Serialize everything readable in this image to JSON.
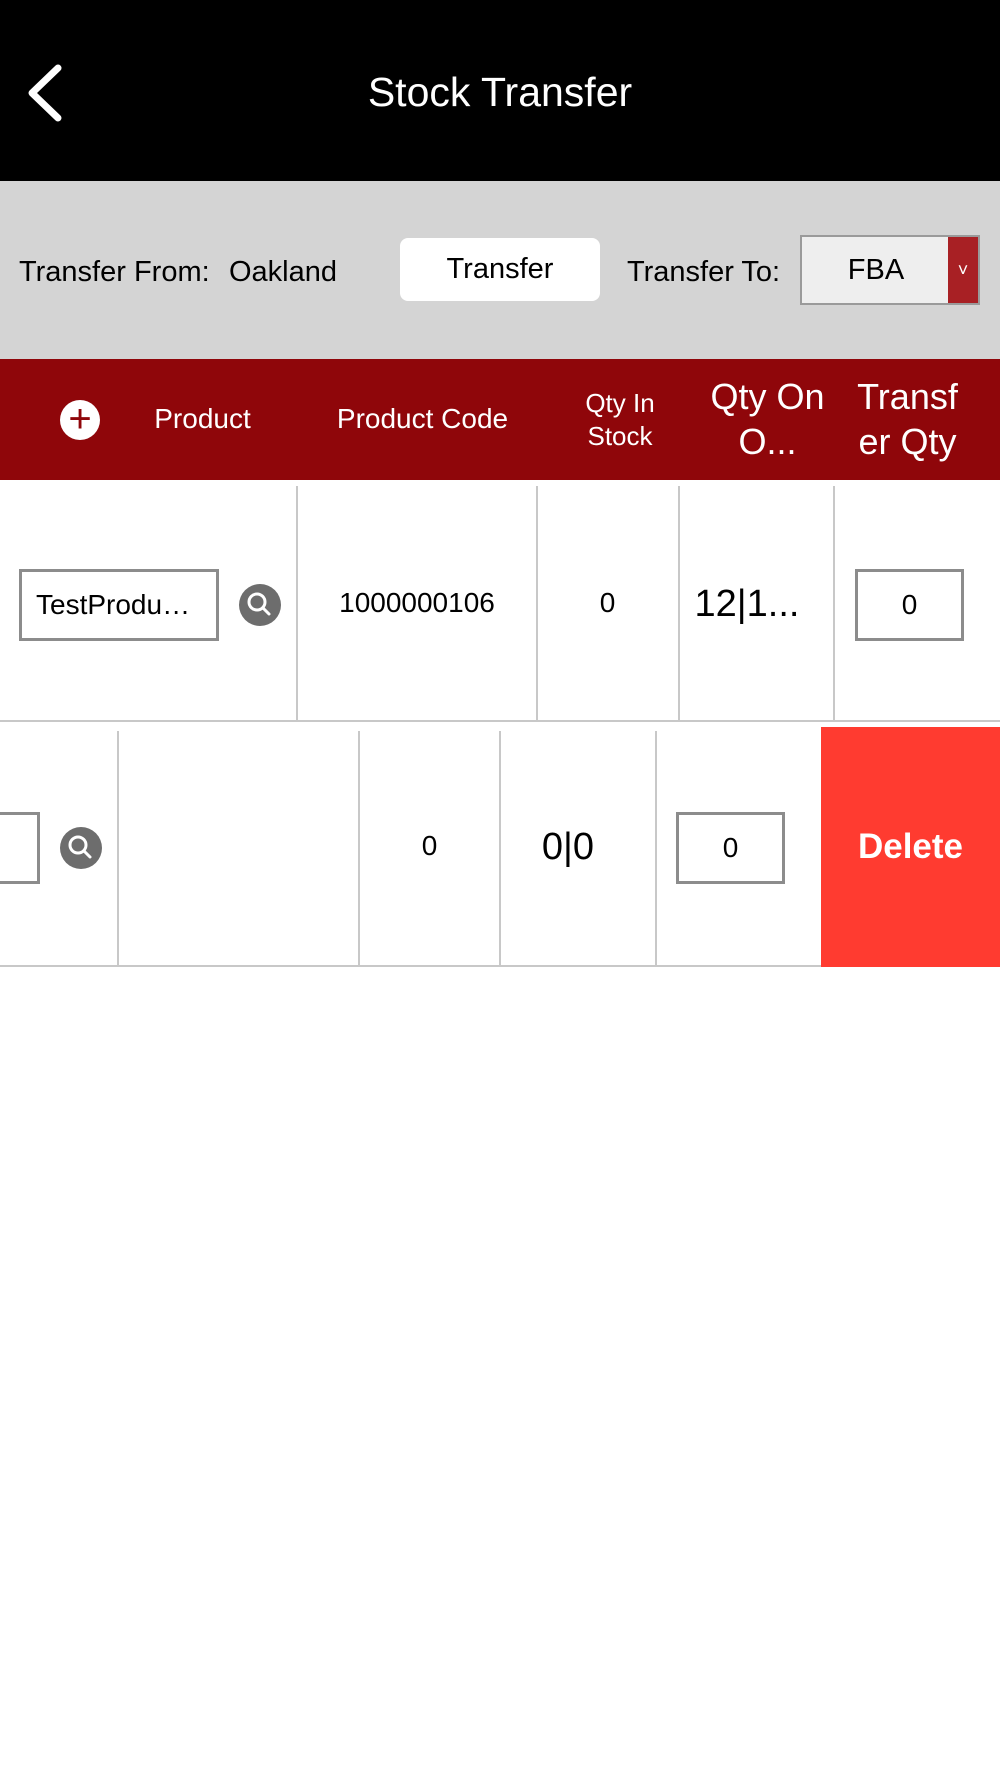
{
  "navbar": {
    "title": "Stock Transfer",
    "back_icon": "chevron-left-icon"
  },
  "filter": {
    "from_label": "Transfer From:",
    "from_value": "Oakland",
    "transfer_button": "Transfer",
    "to_label": "Transfer To:",
    "to_value": "FBA",
    "to_caret": "˅"
  },
  "table": {
    "add_icon": "+",
    "columns": {
      "product": "Product",
      "product_code": "Product Code",
      "qty_in_stock": "Qty In Stock",
      "qty_on_order": "Qty On O...",
      "transfer_qty": "Transf er Qty"
    },
    "rows": [
      {
        "product": "TestProdu…",
        "product_code": "1000000106",
        "qty_in_stock": "0",
        "qty_on_order": "12|1...",
        "transfer_qty": "0"
      },
      {
        "product": "",
        "product_code": "",
        "qty_in_stock": "0",
        "qty_on_order": "0|0",
        "transfer_qty": "0",
        "delete_label": "Delete"
      }
    ]
  },
  "colors": {
    "navbar": "#000000",
    "filter_bar": "#d4d4d4",
    "header": "#8f060a",
    "caret": "#a82024",
    "delete": "#ff3b30"
  }
}
